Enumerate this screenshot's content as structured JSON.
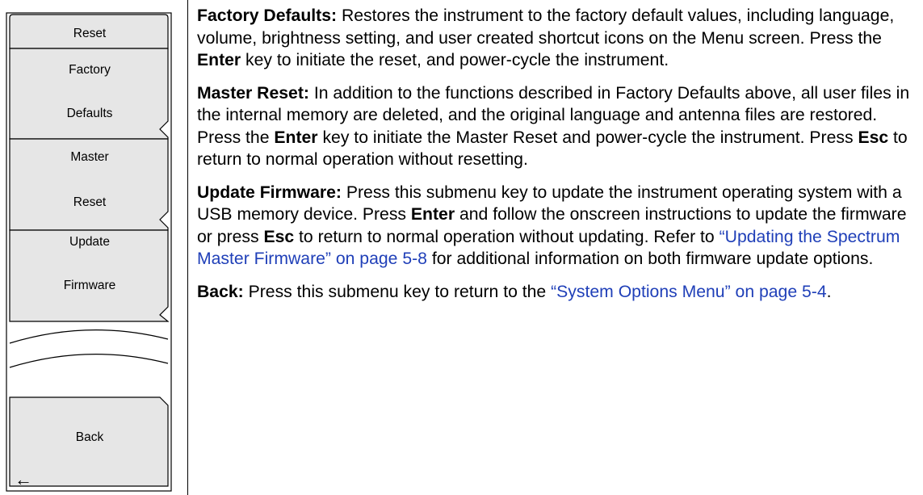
{
  "menu": {
    "title": "Reset",
    "buttons": [
      {
        "line1": "Factory",
        "line2": "Defaults"
      },
      {
        "line1": "Master",
        "line2": "Reset"
      },
      {
        "line1": "Update",
        "line2": "Firmware"
      }
    ],
    "back": {
      "label": "Back",
      "arrow": "←"
    }
  },
  "descriptions": {
    "factory": {
      "term": "Factory Defaults:",
      "t1": " Restores the instrument to the factory default values, including language, volume, brightness setting, and user created shortcut icons on the Menu screen. Press the ",
      "k1": "Enter",
      "t2": " key to initiate the reset, and power-cycle the instrument."
    },
    "master": {
      "term": "Master Reset:",
      "t1": " In addition to the functions described in Factory Defaults above, all user files in the internal memory are deleted, and the original language and antenna files are restored. Press the ",
      "k1": "Enter",
      "t2": " key to initiate the Master Reset and power-cycle the instrument. Press ",
      "k2": "Esc",
      "t3": " to return to normal operation without resetting."
    },
    "update": {
      "term": "Update Firmware:",
      "t1": " Press this submenu key to update the instrument operating system with a USB memory device. Press ",
      "k1": "Enter",
      "t2": " and follow the onscreen instructions to update the firmware or press ",
      "k2": "Esc",
      "t3": " to return to normal operation without updating. Refer to ",
      "link": "“Updating the Spectrum Master Firmware” on page 5-8",
      "t4": " for additional information on both firmware update options."
    },
    "back": {
      "term": "Back:",
      "t1": " Press this submenu key to return to the ",
      "link": "“System Options Menu” on page 5-4",
      "t2": "."
    }
  },
  "colors": {
    "key_fill": "#e6e6e6",
    "link": "#1f3fb8",
    "outline": "#000000"
  }
}
